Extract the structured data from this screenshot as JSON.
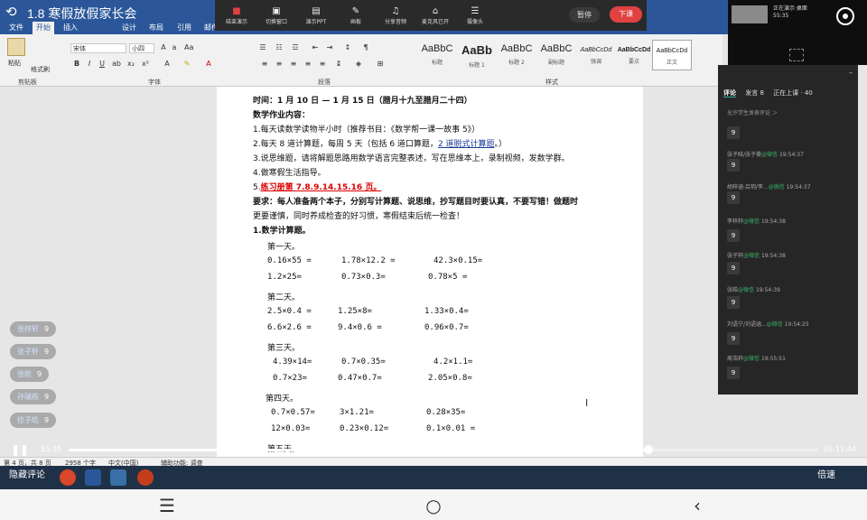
{
  "window": {
    "title": "1.8 寒假放假家长会"
  },
  "menu": {
    "items": [
      "文件",
      "开始",
      "插入",
      "设计",
      "布局",
      "引用",
      "邮件"
    ],
    "active_index": 1
  },
  "ribbon": {
    "paste_label": "粘贴",
    "format_painter": "格式刷",
    "font_name": "宋体",
    "font_size": "小四",
    "group_clipboard": "剪贴板",
    "group_font": "字体",
    "group_paragraph": "段落",
    "group_styles": "样式",
    "styles": [
      {
        "sample": "AaBbC",
        "name": "标题"
      },
      {
        "sample": "AaBb",
        "name": "标题 1"
      },
      {
        "sample": "AaBbC",
        "name": "标题 2"
      },
      {
        "sample": "AaBbC",
        "name": "副标题"
      },
      {
        "sample": "AaBbCcDd",
        "name": "强调"
      },
      {
        "sample": "AaBbCcDd",
        "name": "要点"
      },
      {
        "sample": "AaBbCcDd",
        "name": "正文"
      }
    ]
  },
  "livebar": {
    "buttons": [
      {
        "icon": "■",
        "label": "结束演示"
      },
      {
        "icon": "▣",
        "label": "切换窗口"
      },
      {
        "icon": "▤",
        "label": "演示PPT"
      },
      {
        "icon": "✎",
        "label": "画板"
      },
      {
        "icon": "♫",
        "label": "分享音频"
      },
      {
        "icon": "⌂",
        "label": "麦克风已开"
      },
      {
        "icon": "☰",
        "label": "摄像头"
      }
    ],
    "pause": "暂停",
    "end": "下课"
  },
  "camera": {
    "line1": "正在演示·桌面",
    "line2": "55:35"
  },
  "comments": {
    "tabs": [
      "评论",
      "发言 8",
      "正在上课 · 40"
    ],
    "notice": "允许学生发表评论 ＞",
    "items": [
      {
        "name": "",
        "time": "",
        "msg": "9"
      },
      {
        "name": "张子晗/张子豪",
        "tag": "@微信",
        "time": "19:54:37",
        "msg": "9"
      },
      {
        "name": "胡梓涵·吕玥/李...",
        "tag": "@微信",
        "time": "19:54:37",
        "msg": "9"
      },
      {
        "name": "李梓轩",
        "tag": "@微信",
        "time": "19:54:38",
        "msg": "9"
      },
      {
        "name": "张子轩",
        "tag": "@微信",
        "time": "19:54:38",
        "msg": "9"
      },
      {
        "name": "张皓",
        "tag": "@微信",
        "time": "19:54:39",
        "msg": "9"
      },
      {
        "name": "刘语宁/刘语涵...",
        "tag": "@微信",
        "time": "19:54:25",
        "msg": "9"
      },
      {
        "name": "周浩轩",
        "tag": "@微信",
        "time": "19:55:51",
        "msg": "9"
      }
    ]
  },
  "floating": [
    {
      "name": "张梓轩",
      "msg": "9"
    },
    {
      "name": "张子轩",
      "msg": "9"
    },
    {
      "name": "张皓",
      "msg": "9"
    },
    {
      "name": "孙瑞栋",
      "msg": "9"
    },
    {
      "name": "徐子皓",
      "msg": "9"
    }
  ],
  "doc": {
    "time_line": "时间：1 月 10 日 — 1 月 15 日（腊月十九至腊月二十四）",
    "heading": "数学作业内容：",
    "items": [
      "1.每天读数学读物半小时（推荐书目：《数学帮一课一故事 5》）",
      "2.每天 8 道计算题，每周 5 天（包括 6 道口算题，",
      "3.说思维题，请将解题思路用数学语言完整表述，写在思维本上，录制视频，发数学群。",
      "4.做寒假生活指导。",
      "5.",
      "要求：每人准备两个本子，分别写计算题、说思维，抄写题目时要认真，不要写错！做题时",
      "更要谨慎，同时养成检查的好习惯，寒假结束后统一检查！",
      "1.数学计算题。"
    ],
    "item2_link": "2 道脱式计算题",
    "item2_tail": "。）",
    "item5_red": "练习册第 7.8.9.14.15.16 页。",
    "days": [
      {
        "label": "第一天。",
        "rows": [
          [
            "0.16×55 =",
            "1.78×12.2 =",
            "42.3×0.15="
          ],
          [
            "1.2×25=",
            "0.73×0.3=",
            "0.78×5 ="
          ]
        ]
      },
      {
        "label": "第二天。",
        "rows": [
          [
            "2.5×0.4 =",
            "1.25×8=",
            "1.33×0.4="
          ],
          [
            "6.6×2.6 =",
            "9.4×0.6 =",
            "0.96×0.7="
          ]
        ]
      },
      {
        "label": "第三天。",
        "rows": [
          [
            "4.39×14=",
            "0.7×0.35=",
            "4.2×1.1="
          ],
          [
            "0.7×23=",
            "0.47×0.7=",
            "2.05×0.8="
          ]
        ]
      },
      {
        "label": "第四天。",
        "rows": [
          [
            "0.7×0.57=",
            "3×1.21=",
            "0.28×35="
          ],
          [
            "12×0.03=",
            "0.23×0.12=",
            "0.1×0.01 ="
          ]
        ]
      },
      {
        "label": "第五天。",
        "rows": []
      }
    ]
  },
  "wordstatus": {
    "page": "第 4 页，共 8 页",
    "words": "2958 个字",
    "lang": "中文(中国)",
    "assist": "辅助功能: 调查"
  },
  "player": {
    "current": "55:35",
    "total": "01:11:44",
    "progress_fraction": 0.773,
    "hide_comments": "隐藏评论",
    "speed": "倍速"
  },
  "colors": {
    "word_blue": "#2b579a",
    "end_red": "#e04141",
    "wechat_green": "#3bb36b"
  }
}
